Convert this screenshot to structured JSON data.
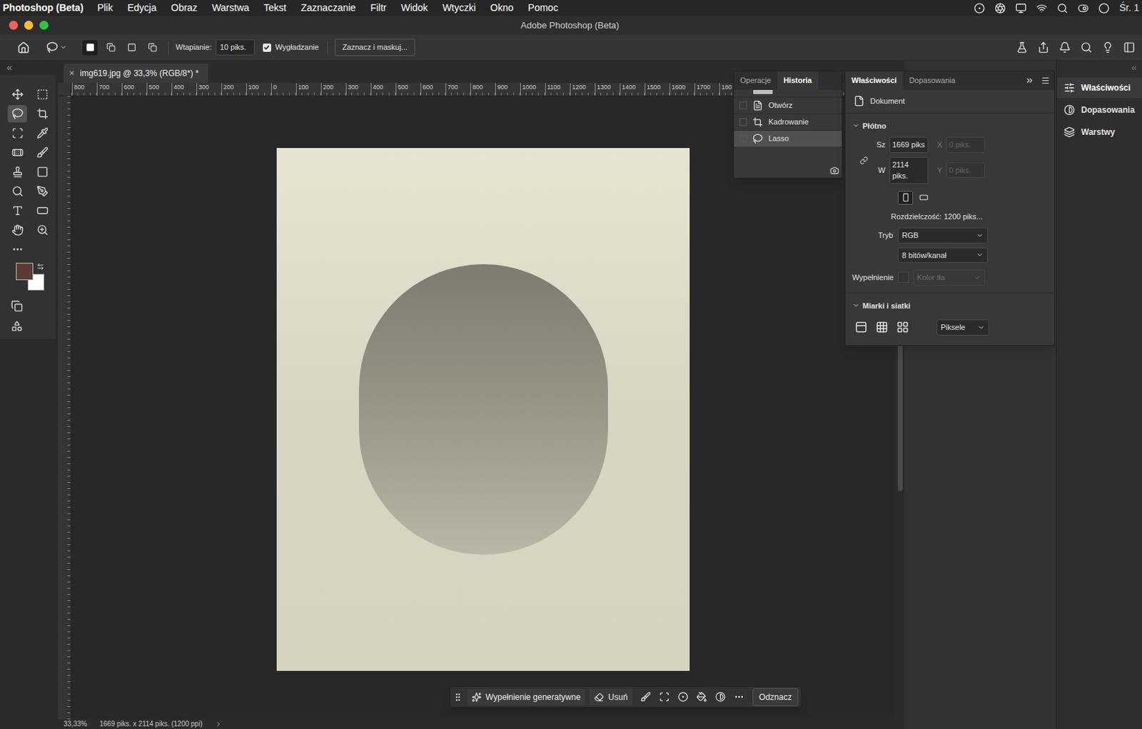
{
  "menubar": {
    "app": "Photoshop (Beta)",
    "items": [
      "Plik",
      "Edycja",
      "Obraz",
      "Warstwa",
      "Tekst",
      "Zaznaczanie",
      "Filtr",
      "Widok",
      "Wtyczki",
      "Okno",
      "Pomoc"
    ],
    "clock": "Śr. 1"
  },
  "window": {
    "title": "Adobe Photoshop (Beta)"
  },
  "options_bar": {
    "modes": [
      {
        "selected": true
      },
      {
        "selected": false
      },
      {
        "selected": false
      },
      {
        "selected": false
      }
    ],
    "feather_label": "Wtapianie:",
    "feather_value": "10 piks.",
    "antialias": {
      "label": "Wygładzanie",
      "checked": true
    },
    "select_mask": "Zaznacz i maskuj..."
  },
  "document_tab": {
    "title": "img619.jpg @ 33,3% (RGB/8*) *",
    "close": "×"
  },
  "ruler": {
    "labels": [
      "800",
      "700",
      "600",
      "500",
      "400",
      "300",
      "200",
      "100",
      "0",
      "100",
      "200",
      "300",
      "400",
      "500",
      "600",
      "700",
      "800",
      "900",
      "1000",
      "1100",
      "1200",
      "1300",
      "1400",
      "1500",
      "1600",
      "1700",
      "180"
    ]
  },
  "tools": [
    {
      "selected": false
    },
    {
      "selected": false
    },
    {
      "selected": true
    },
    {
      "selected": false
    },
    {
      "selected": false
    },
    {
      "selected": false
    },
    {
      "selected": false
    },
    {
      "selected": false
    },
    {
      "selected": false
    },
    {
      "selected": false
    },
    {
      "selected": false
    },
    {
      "selected": false
    },
    {
      "selected": false
    },
    {
      "selected": false
    },
    {
      "selected": false
    },
    {
      "selected": false
    }
  ],
  "colors": {
    "foreground": "#5a3a35",
    "background": "#ffffff"
  },
  "history_panel": {
    "tabs": [
      {
        "label": "Operacje",
        "selected": false
      },
      {
        "label": "Historia",
        "selected": true
      }
    ],
    "items": [
      {
        "label": "Otwórz",
        "selected": false
      },
      {
        "label": "Kadrowanie",
        "selected": false
      },
      {
        "label": "Lasso",
        "selected": true
      }
    ]
  },
  "properties_panel": {
    "tabs": [
      {
        "label": "Właściwości",
        "selected": true
      },
      {
        "label": "Dopasowania",
        "selected": false
      }
    ],
    "header": "Dokument",
    "canvas": {
      "title": "Płótno",
      "expanded": true,
      "fields": [
        {
          "label": "Sz",
          "value": "1669 piks",
          "disabled": false
        },
        {
          "label": "X",
          "value": "0 piks.",
          "disabled": true
        },
        {
          "label": "W",
          "value": "2114 piks.",
          "disabled": false
        },
        {
          "label": "Y",
          "value": "0 piks.",
          "disabled": true
        }
      ],
      "orientation": [
        {
          "selected": true
        },
        {
          "selected": false
        }
      ],
      "resolution": "Rozdzielczość: 1200 piks...",
      "mode_label": "Tryb",
      "mode": "RGB",
      "depth": "8 bitów/kanał",
      "fill_label": "Wypełnienie",
      "fill": {
        "value": "Kolor tła",
        "disabled": true
      }
    },
    "rulers": {
      "title": "Miarki i siatki",
      "expanded": true,
      "unit": "Piksele"
    }
  },
  "dock": [
    {
      "label": "Właściwości",
      "selected": true
    },
    {
      "label": "Dopasowania",
      "selected": false
    },
    {
      "label": "Warstwy",
      "selected": false
    }
  ],
  "taskbar": {
    "generative_fill": "Wypełnienie generatywne",
    "remove": "Usuń",
    "deselect": "Odznacz"
  },
  "status_bar": {
    "zoom": "33,33%",
    "info": "1669 piks. x 2114 piks. (1200 ppi)"
  }
}
